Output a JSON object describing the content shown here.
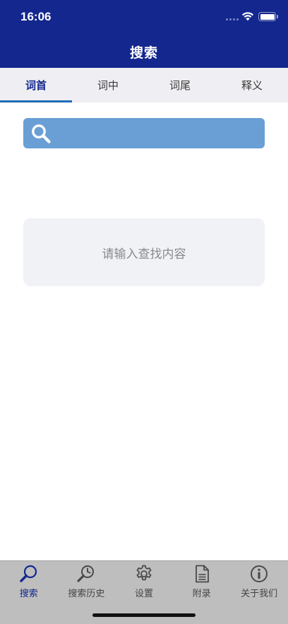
{
  "status_bar": {
    "time": "16:06"
  },
  "nav": {
    "title": "搜索"
  },
  "tabs": [
    {
      "label": "词首",
      "active": true
    },
    {
      "label": "词中",
      "active": false
    },
    {
      "label": "词尾",
      "active": false
    },
    {
      "label": "释义",
      "active": false
    }
  ],
  "search": {
    "value": "",
    "icon": "search-icon"
  },
  "empty_state": {
    "message": "请输入查找内容"
  },
  "bottom_nav": [
    {
      "label": "搜索",
      "icon": "search-icon",
      "active": true
    },
    {
      "label": "搜索历史",
      "icon": "history-icon",
      "active": false
    },
    {
      "label": "设置",
      "icon": "gear-icon",
      "active": false
    },
    {
      "label": "附录",
      "icon": "document-icon",
      "active": false
    },
    {
      "label": "关于我们",
      "icon": "info-icon",
      "active": false
    }
  ],
  "colors": {
    "primary": "#13278e",
    "tab_indicator": "#1d6bb8",
    "search_box": "#6a9fd5",
    "tab_bar": "#efeff3",
    "bottom_bar": "#bebebe"
  }
}
